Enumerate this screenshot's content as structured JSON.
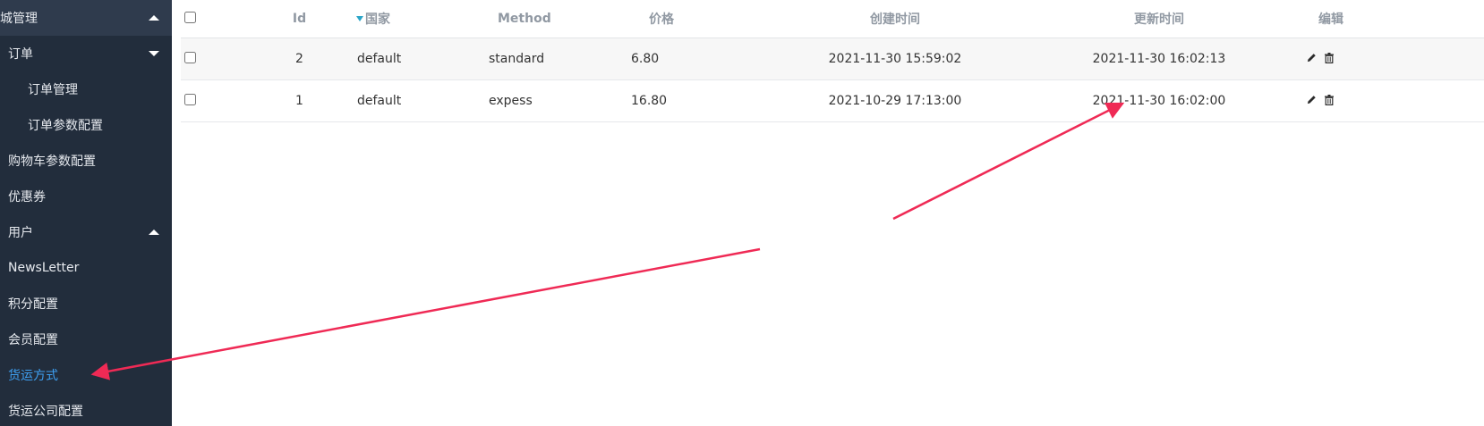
{
  "sidebar": {
    "header": "城管理",
    "items": [
      {
        "label": "订单",
        "toggle": "down"
      },
      {
        "label": "订单管理"
      },
      {
        "label": "订单参数配置"
      },
      {
        "label": "购物车参数配置"
      },
      {
        "label": "优惠券"
      },
      {
        "label": "用户",
        "toggle": "up"
      },
      {
        "label": "NewsLetter"
      },
      {
        "label": "积分配置"
      },
      {
        "label": "会员配置"
      },
      {
        "label": "货运方式",
        "active": true
      },
      {
        "label": "货运公司配置"
      }
    ]
  },
  "table": {
    "columns": [
      "Id",
      "国家",
      "Method",
      "价格",
      "创建时间",
      "更新时间",
      "编辑"
    ],
    "sorted_column": "国家",
    "rows": [
      {
        "id": "2",
        "country": "default",
        "method": "standard",
        "price": "6.80",
        "created": "2021-11-30 15:59:02",
        "updated": "2021-11-30 16:02:13"
      },
      {
        "id": "1",
        "country": "default",
        "method": "expess",
        "price": "16.80",
        "created": "2021-10-29 17:13:00",
        "updated": "2021-11-30 16:02:00"
      }
    ],
    "row_actions": [
      "pencil-icon",
      "trash-icon"
    ]
  },
  "colors": {
    "sidebar_bg": "#222d3c",
    "sidebar_header_bg": "#2f3b4d",
    "active_link": "#3ea0f2",
    "annotation_arrow": "#ef2a55"
  }
}
